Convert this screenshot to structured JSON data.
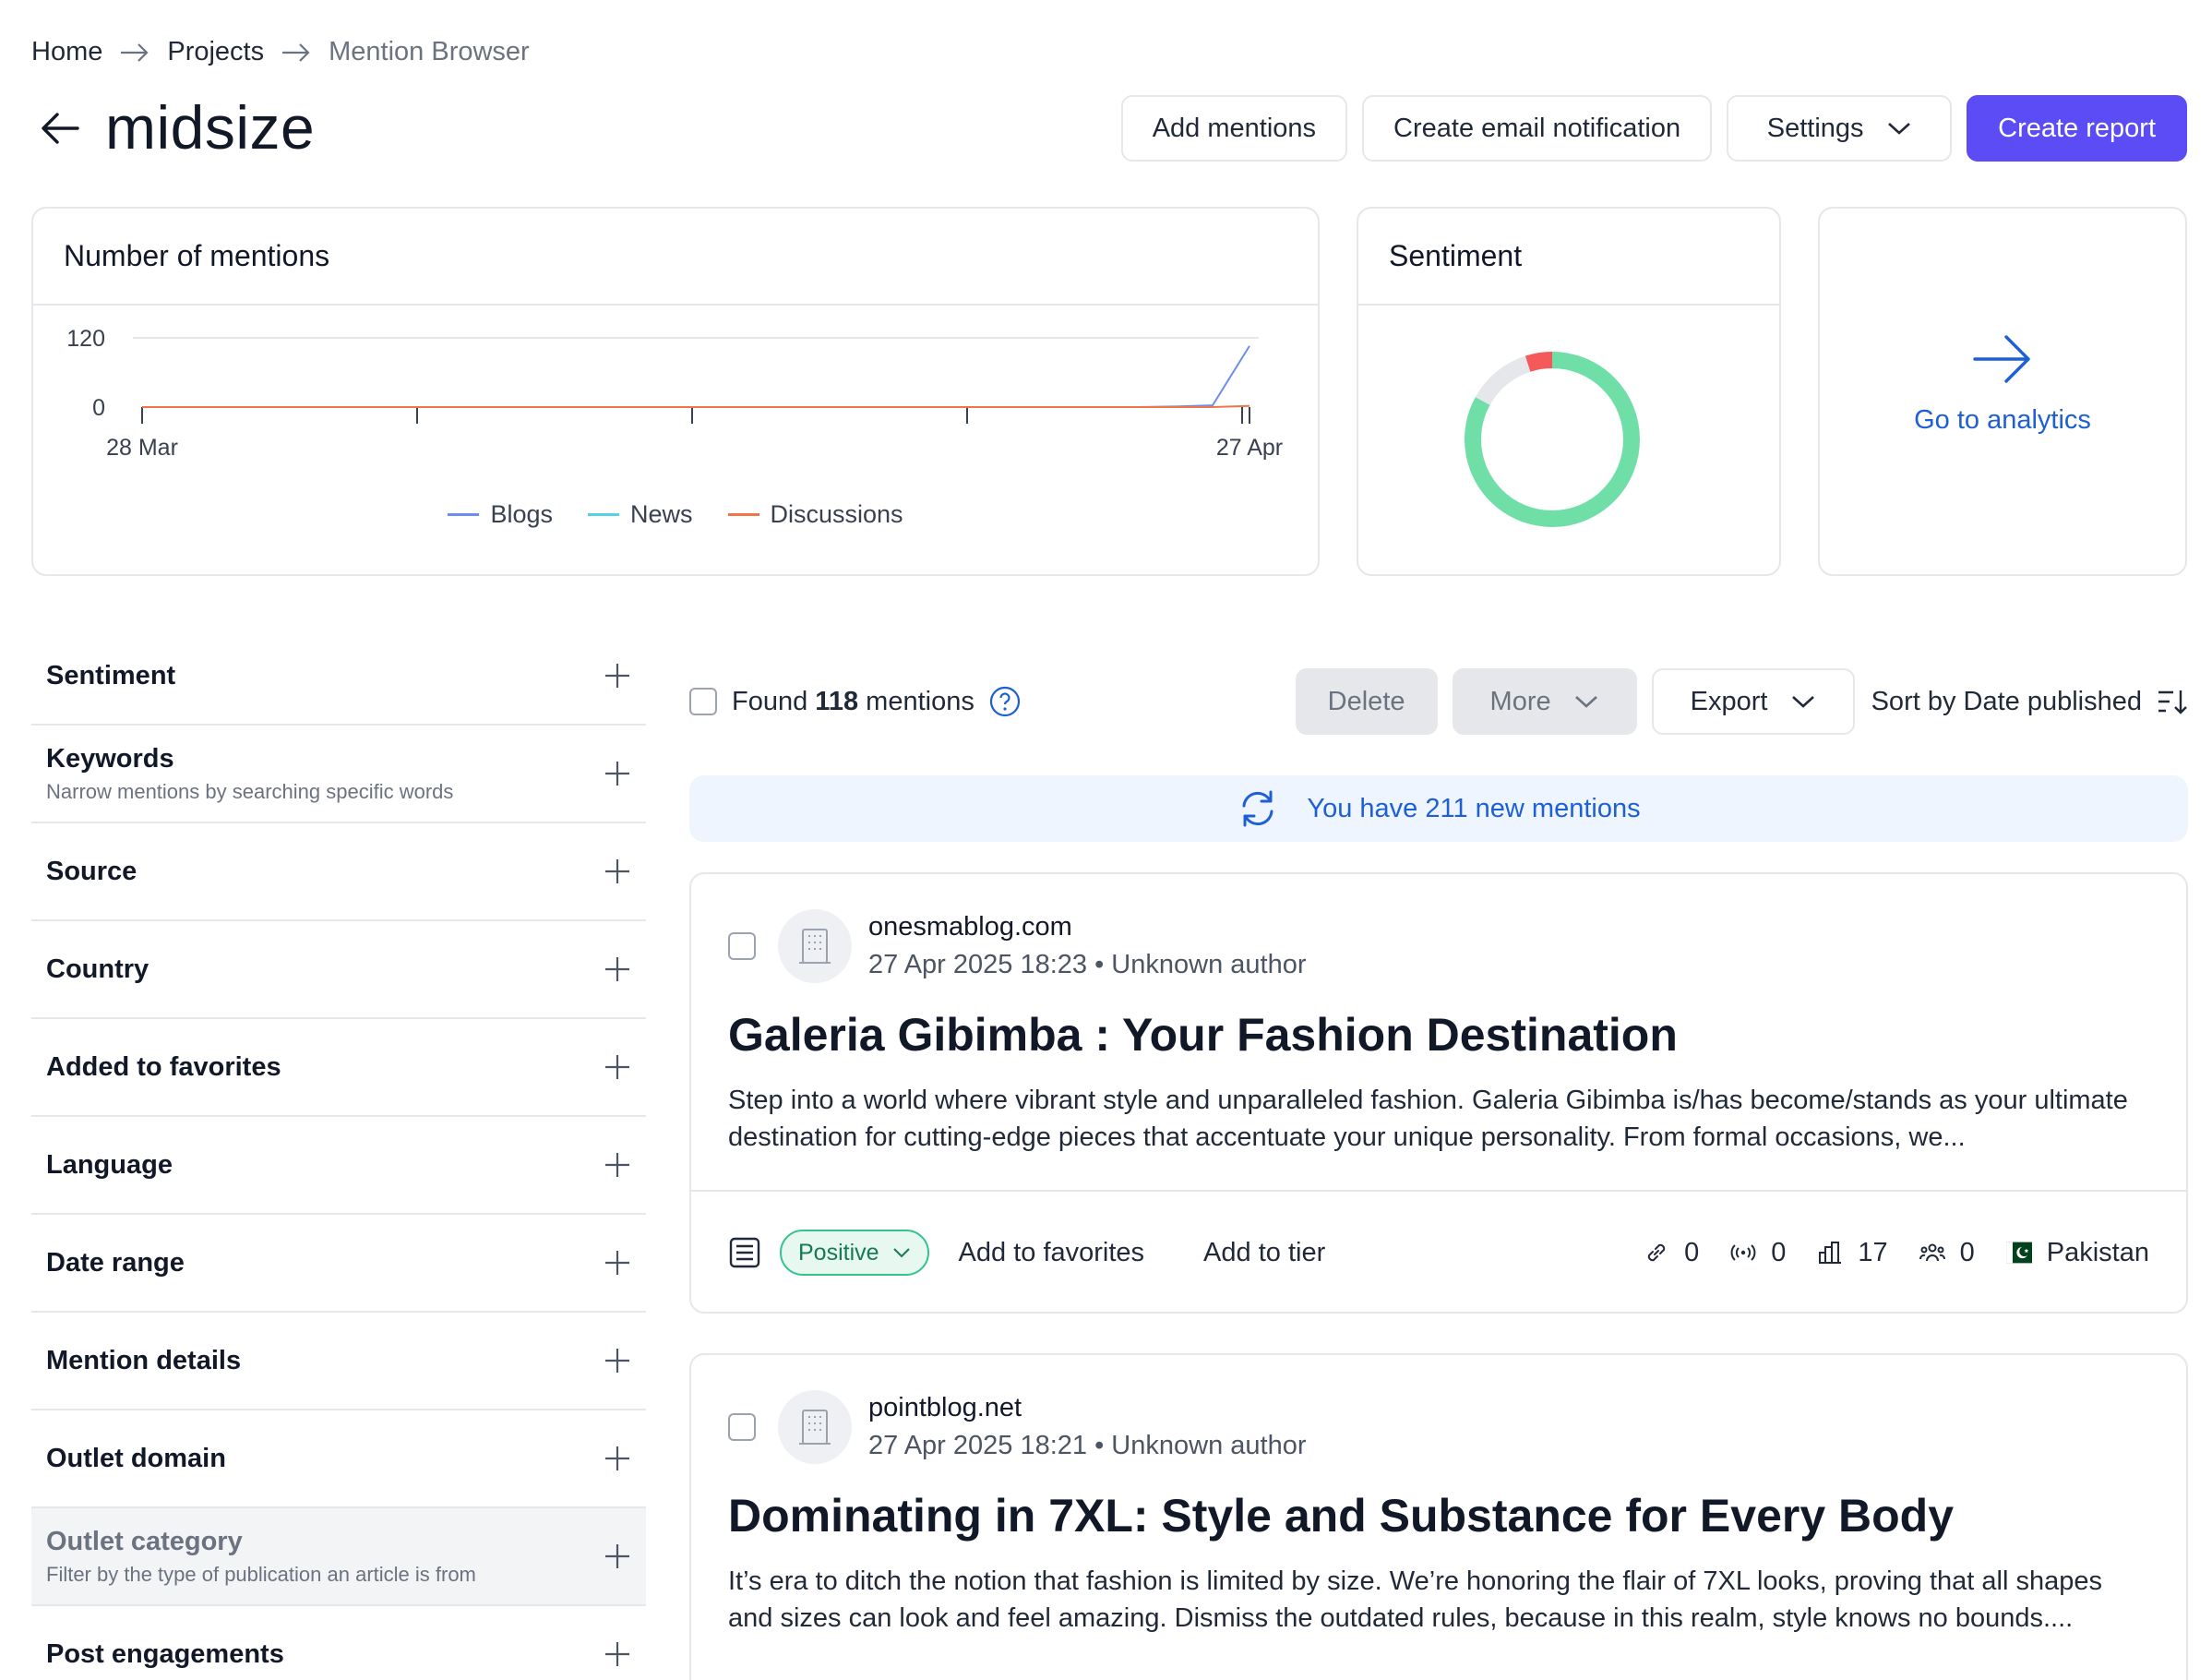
{
  "breadcrumb": {
    "home": "Home",
    "projects": "Projects",
    "current": "Mention Browser"
  },
  "header": {
    "title": "midsize",
    "add_mentions": "Add mentions",
    "create_notification": "Create email notification",
    "settings": "Settings",
    "create_report": "Create report"
  },
  "mentions_card": {
    "title": "Number of mentions"
  },
  "chart_data": {
    "type": "line",
    "x_start": "28 Mar",
    "x_end": "27 Apr",
    "x_tick_labels": [
      "28 Mar",
      "27 Apr"
    ],
    "y_tick_labels": [
      "120",
      "0"
    ],
    "ylim": [
      0,
      120
    ],
    "days": 31,
    "series": [
      {
        "name": "Blogs",
        "color": "#6b8ef0",
        "points": [
          {
            "day": 29,
            "value": 1
          },
          {
            "day": 30,
            "value": 3
          },
          {
            "day": 31,
            "value": 106
          }
        ]
      },
      {
        "name": "News",
        "color": "#53d3e8",
        "points": []
      },
      {
        "name": "Discussions",
        "color": "#f0764a",
        "points": [
          {
            "day": 31,
            "value": 2
          }
        ]
      }
    ],
    "legend_position": "bottom",
    "grid": true
  },
  "sentiment_card": {
    "title": "Sentiment",
    "donut": [
      {
        "label": "positive",
        "fraction": 0.83,
        "color": "#6fdfa7"
      },
      {
        "label": "neutral",
        "fraction": 0.12,
        "color": "#e5e7eb"
      },
      {
        "label": "negative",
        "fraction": 0.05,
        "color": "#f55a5a"
      }
    ]
  },
  "analytics_card": {
    "link": "Go to analytics"
  },
  "filters": [
    {
      "title": "Sentiment",
      "subtitle": ""
    },
    {
      "title": "Keywords",
      "subtitle": "Narrow mentions by searching specific words"
    },
    {
      "title": "Source",
      "subtitle": ""
    },
    {
      "title": "Country",
      "subtitle": ""
    },
    {
      "title": "Added to favorites",
      "subtitle": ""
    },
    {
      "title": "Language",
      "subtitle": ""
    },
    {
      "title": "Date range",
      "subtitle": ""
    },
    {
      "title": "Mention details",
      "subtitle": ""
    },
    {
      "title": "Outlet domain",
      "subtitle": ""
    },
    {
      "title": "Outlet category",
      "subtitle": "Filter by the type of publication an article is from"
    },
    {
      "title": "Post engagements",
      "subtitle": ""
    }
  ],
  "toolbar": {
    "found_prefix": "Found",
    "found_count": "118",
    "found_suffix": "mentions",
    "delete": "Delete",
    "more": "More",
    "export": "Export",
    "sort": "Sort by Date published"
  },
  "banner": {
    "text": "You have 211 new mentions"
  },
  "mentions": [
    {
      "domain": "onesmablog.com",
      "date": "27 Apr 2025 18:23 • Unknown author",
      "title": "Galeria Gibimba : Your Fashion Destination",
      "excerpt": "Step into a world where vibrant style and unparalleled fashion. Galeria Gibimba is/has become/stands as your ultimate destination for cutting-edge pieces that accentuate your unique personality. From formal occasions, we...",
      "sentiment": "Positive",
      "add_favorites": "Add to favorites",
      "add_tier": "Add to tier",
      "links": "0",
      "reach": "0",
      "rank": "17",
      "engagement": "0",
      "country": "Pakistan"
    },
    {
      "domain": "pointblog.net",
      "date": "27 Apr 2025 18:21 • Unknown author",
      "title": "Dominating in 7XL: Style and Substance for Every Body",
      "excerpt": "It’s era to ditch the notion that fashion is limited by size. We’re honoring the flair of 7XL looks, proving that all shapes and sizes can look and feel amazing. Dismiss the outdated rules, because in this realm, style knows no bounds...."
    }
  ]
}
